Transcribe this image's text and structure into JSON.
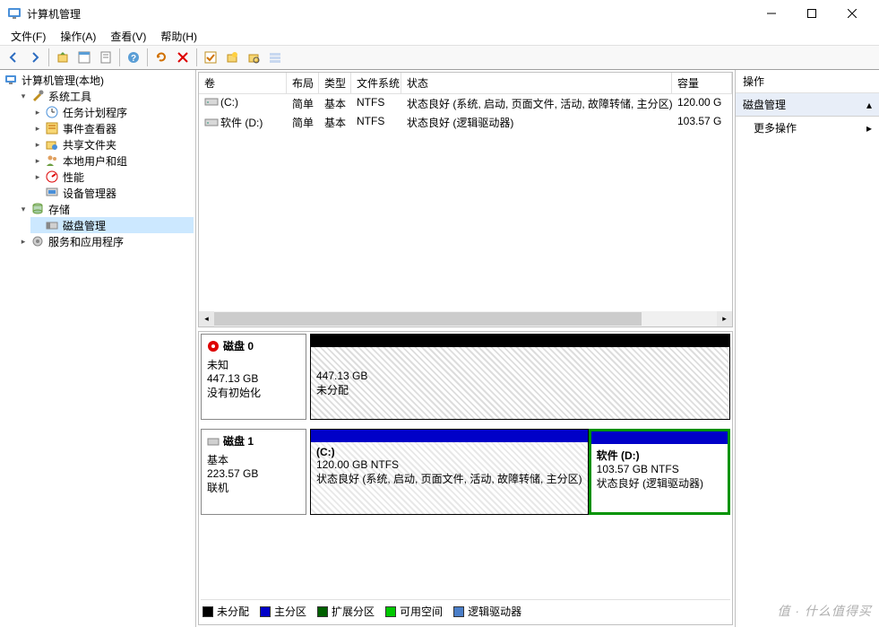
{
  "window": {
    "title": "计算机管理"
  },
  "menu": {
    "file": "文件(F)",
    "action": "操作(A)",
    "view": "查看(V)",
    "help": "帮助(H)"
  },
  "tree": {
    "root": "计算机管理(本地)",
    "sys_tools": "系统工具",
    "task_sched": "任务计划程序",
    "event_viewer": "事件查看器",
    "shared": "共享文件夹",
    "users": "本地用户和组",
    "perf": "性能",
    "devmgr": "设备管理器",
    "storage": "存储",
    "diskmgmt": "磁盘管理",
    "services": "服务和应用程序"
  },
  "columns": {
    "volume": "卷",
    "layout": "布局",
    "type": "类型",
    "fs": "文件系统",
    "status": "状态",
    "capacity": "容量"
  },
  "vols": [
    {
      "name": "(C:)",
      "layout": "简单",
      "type": "基本",
      "fs": "NTFS",
      "status": "状态良好 (系统, 启动, 页面文件, 活动, 故障转储, 主分区)",
      "capacity": "120.00 G"
    },
    {
      "name": "软件 (D:)",
      "layout": "简单",
      "type": "基本",
      "fs": "NTFS",
      "status": "状态良好 (逻辑驱动器)",
      "capacity": "103.57 G"
    }
  ],
  "disk0": {
    "title": "磁盘 0",
    "state": "未知",
    "size": "447.13 GB",
    "init": "没有初始化",
    "part_size": "447.13 GB",
    "part_state": "未分配"
  },
  "disk1": {
    "title": "磁盘 1",
    "type": "基本",
    "size": "223.57 GB",
    "state": "联机",
    "c": {
      "name": "(C:)",
      "size": "120.00 GB NTFS",
      "status": "状态良好 (系统, 启动, 页面文件, 活动, 故障转储, 主分区)"
    },
    "d": {
      "name": "软件  (D:)",
      "size": "103.57 GB NTFS",
      "status": "状态良好 (逻辑驱动器)"
    }
  },
  "legend": {
    "unalloc": "未分配",
    "primary": "主分区",
    "extended": "扩展分区",
    "free": "可用空间",
    "logical": "逻辑驱动器"
  },
  "actions": {
    "head": "操作",
    "section": "磁盘管理",
    "more": "更多操作"
  },
  "watermark": "值 · 什么值得买"
}
